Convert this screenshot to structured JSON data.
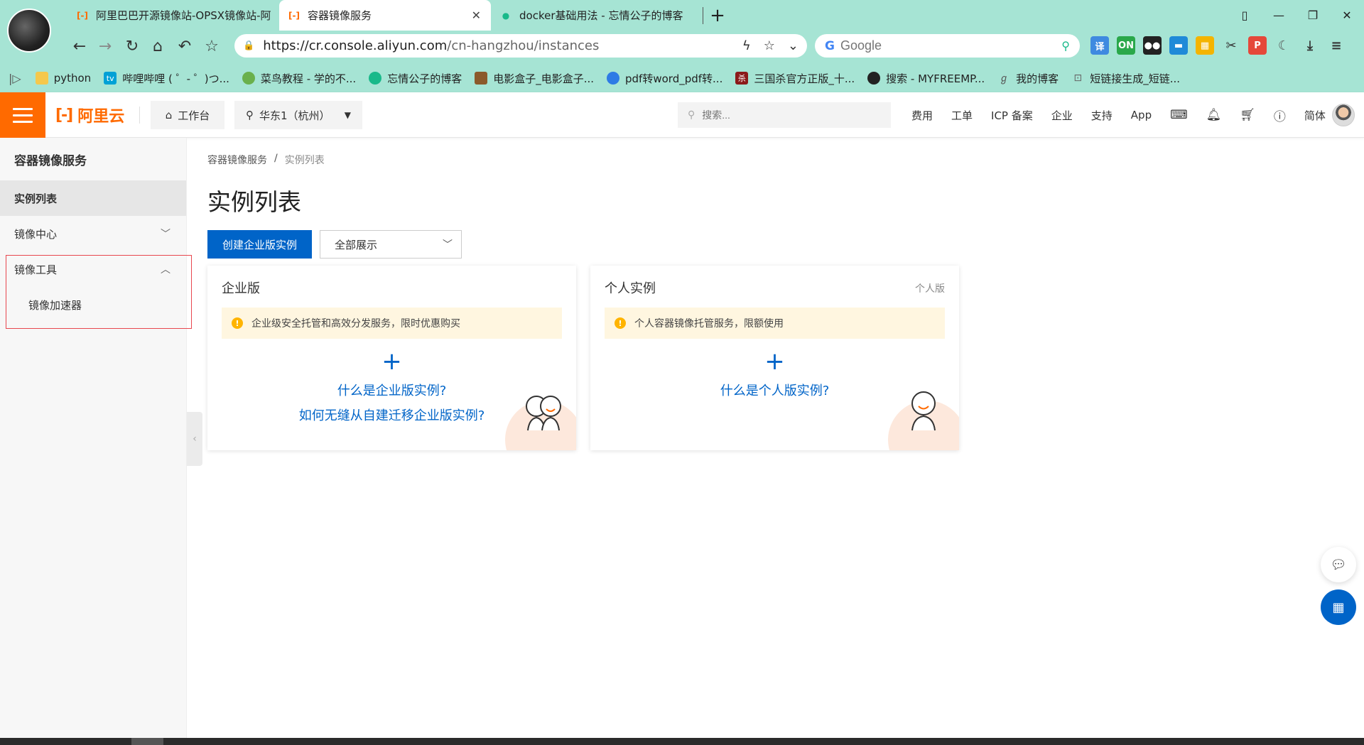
{
  "browser": {
    "tabs": [
      {
        "title": "阿里巴巴开源镜像站-OPSX镜像站-阿",
        "favicon": "aliyun-icon",
        "active": false
      },
      {
        "title": "容器镜像服务",
        "favicon": "aliyun-icon",
        "active": true
      },
      {
        "title": "docker基础用法 - 忘情公子的博客",
        "favicon": "blog-icon",
        "active": false
      }
    ],
    "url_main": "https://cr.console.aliyun.com",
    "url_path": "/cn-hangzhou/instances",
    "search_placeholder": "Google",
    "bookmarks": [
      {
        "label": "python",
        "icon": "folder-icon",
        "color": "#f5c84c"
      },
      {
        "label": "哔哩哔哩 ( ゜- ゜)つ...",
        "icon": "bilibili-icon",
        "color": "#00a1d6"
      },
      {
        "label": "菜鸟教程 - 学的不...",
        "icon": "runoob-icon",
        "color": "#6ab04c"
      },
      {
        "label": "忘情公子的博客",
        "icon": "blog-icon",
        "color": "#19b98a"
      },
      {
        "label": "电影盒子_电影盒子...",
        "icon": "movie-icon",
        "color": "#8b5a2b"
      },
      {
        "label": "pdf转word_pdf转...",
        "icon": "pdf-icon",
        "color": "#2d7be5"
      },
      {
        "label": "三国杀官方正版_十...",
        "icon": "sanguosha-icon",
        "color": "#8b1a1a"
      },
      {
        "label": "搜索 - MYFREEMP...",
        "icon": "music-icon",
        "color": "#222222"
      },
      {
        "label": "我的博客",
        "icon": "blog-icon",
        "color": "#555555"
      },
      {
        "label": "短链接生成_短链...",
        "icon": "link-icon",
        "color": "#666666"
      }
    ]
  },
  "console": {
    "logo_text": "阿里云",
    "workbench": "工作台",
    "region": "华东1（杭州）",
    "search_placeholder": "搜索...",
    "links": [
      "费用",
      "工单",
      "ICP 备案",
      "企业",
      "支持",
      "App"
    ],
    "lang": "简体"
  },
  "sidebar": {
    "title": "容器镜像服务",
    "items": [
      {
        "label": "实例列表",
        "active": true
      },
      {
        "label": "镜像中心",
        "expanded": false
      },
      {
        "label": "镜像工具",
        "expanded": true
      }
    ],
    "subitems": [
      "镜像加速器"
    ]
  },
  "main": {
    "breadcrumb": [
      "容器镜像服务",
      "实例列表"
    ],
    "title": "实例列表",
    "create_button": "创建企业版实例",
    "filter_value": "全部展示",
    "cards": [
      {
        "title": "企业版",
        "tag": "",
        "notice": "企业级安全托管和高效分发服务，限时优惠购买",
        "links": [
          "什么是企业版实例?",
          "如何无缝从自建迁移企业版实例?"
        ]
      },
      {
        "title": "个人实例",
        "tag": "个人版",
        "notice": "个人容器镜像托管服务，限额使用",
        "links": [
          "什么是个人版实例?"
        ]
      }
    ]
  },
  "colors": {
    "brand": "#ff6a00",
    "primary": "#0064c8",
    "browser_chrome": "#a6e4d4",
    "highlight_border": "#e8474f"
  }
}
